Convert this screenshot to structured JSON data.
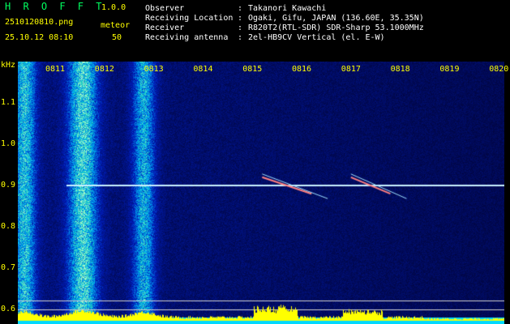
{
  "app": {
    "name": "H R O F F T",
    "version": "1.0.0"
  },
  "capture": {
    "filename": "2510120810.png",
    "datetime": "25.10.12 08:10",
    "mode_label": "meteor",
    "meteor_count": "50"
  },
  "station": [
    {
      "label": "Observer",
      "sep": ":",
      "value": "Takanori Kawachi"
    },
    {
      "label": "Receiving Location",
      "sep": ":",
      "value": "Ogaki, Gifu, JAPAN (136.60E, 35.35N)"
    },
    {
      "label": "Receiver",
      "sep": ":",
      "value": "R820T2(RTL-SDR) SDR-Sharp 53.1000MHz"
    },
    {
      "label": "Receiving antenna",
      "sep": ":",
      "value": "2el-HB9CV Vertical (el. E-W)"
    }
  ],
  "colors": {
    "label": "#ffff00",
    "title": "#00ff60",
    "text": "#ffffff",
    "background": "#000000"
  },
  "chart_data": {
    "type": "heatmap",
    "ylabel": "kHz",
    "x_ticks": [
      "0811",
      "0812",
      "0813",
      "0814",
      "0815",
      "0816",
      "0817",
      "0818",
      "0819",
      "0820"
    ],
    "y_ticks": [
      "1.1",
      "1.0",
      "0.9",
      "0.8",
      "0.7",
      "0.6"
    ],
    "y_tick_values": [
      1.1,
      1.0,
      0.9,
      0.8,
      0.7,
      0.6
    ],
    "carrier_khz": 0.9,
    "bright_time_bands": [
      "0811",
      "0812",
      "0813"
    ],
    "meteor_echoes": [
      {
        "time_start": "0815.2",
        "time_end": "0816.2",
        "freq_start_khz": 0.92,
        "freq_end_khz": 0.88
      },
      {
        "time_start": "0817.0",
        "time_end": "0817.8",
        "freq_start_khz": 0.92,
        "freq_end_khz": 0.88
      }
    ]
  }
}
